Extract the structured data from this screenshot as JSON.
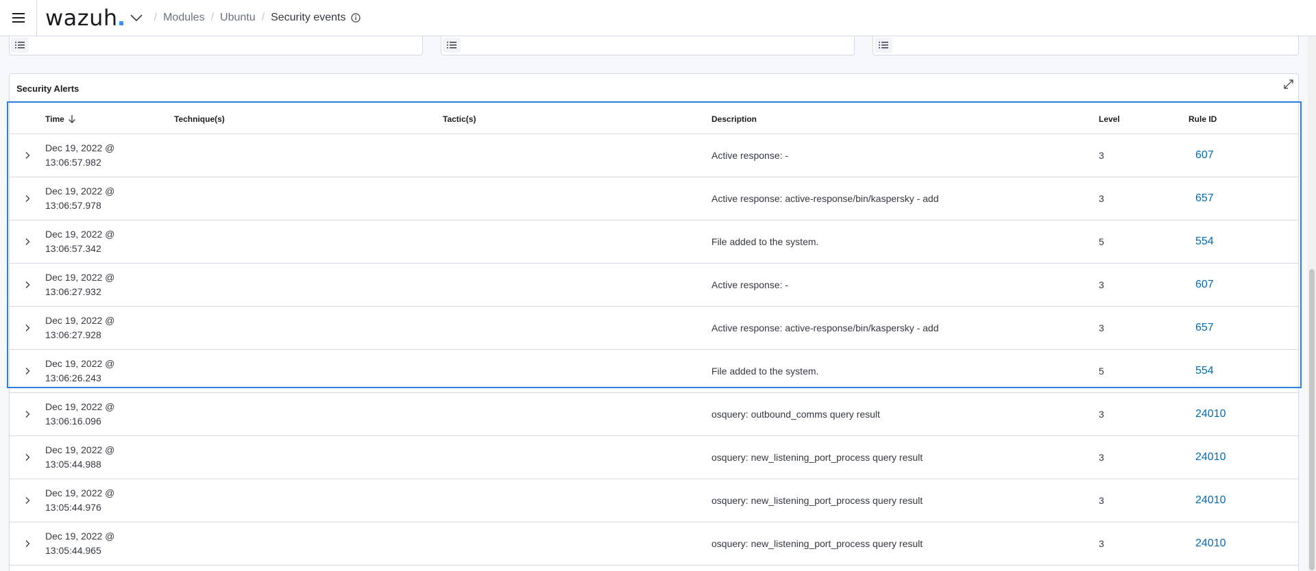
{
  "header": {
    "logo_text": "wazuh",
    "breadcrumbs": [
      {
        "label": "Modules"
      },
      {
        "label": "Ubuntu"
      },
      {
        "label": "Security events"
      }
    ]
  },
  "panel": {
    "title": "Security Alerts"
  },
  "table": {
    "columns": {
      "time": "Time",
      "technique": "Technique(s)",
      "tactic": "Tactic(s)",
      "description": "Description",
      "level": "Level",
      "rule_id": "Rule ID"
    },
    "rows": [
      {
        "date": "Dec 19, 2022 @",
        "clock": "13:06:57.982",
        "technique": "",
        "tactic": "",
        "description": "Active response: -",
        "level": "3",
        "rule_id": "607"
      },
      {
        "date": "Dec 19, 2022 @",
        "clock": "13:06:57.978",
        "technique": "",
        "tactic": "",
        "description": "Active response: active-response/bin/kaspersky - add",
        "level": "3",
        "rule_id": "657"
      },
      {
        "date": "Dec 19, 2022 @",
        "clock": "13:06:57.342",
        "technique": "",
        "tactic": "",
        "description": "File added to the system.",
        "level": "5",
        "rule_id": "554"
      },
      {
        "date": "Dec 19, 2022 @",
        "clock": "13:06:27.932",
        "technique": "",
        "tactic": "",
        "description": "Active response: -",
        "level": "3",
        "rule_id": "607"
      },
      {
        "date": "Dec 19, 2022 @",
        "clock": "13:06:27.928",
        "technique": "",
        "tactic": "",
        "description": "Active response: active-response/bin/kaspersky - add",
        "level": "3",
        "rule_id": "657"
      },
      {
        "date": "Dec 19, 2022 @",
        "clock": "13:06:26.243",
        "technique": "",
        "tactic": "",
        "description": "File added to the system.",
        "level": "5",
        "rule_id": "554"
      },
      {
        "date": "Dec 19, 2022 @",
        "clock": "13:06:16.096",
        "technique": "",
        "tactic": "",
        "description": "osquery: outbound_comms query result",
        "level": "3",
        "rule_id": "24010"
      },
      {
        "date": "Dec 19, 2022 @",
        "clock": "13:05:44.988",
        "technique": "",
        "tactic": "",
        "description": "osquery: new_listening_port_process query result",
        "level": "3",
        "rule_id": "24010"
      },
      {
        "date": "Dec 19, 2022 @",
        "clock": "13:05:44.976",
        "technique": "",
        "tactic": "",
        "description": "osquery: new_listening_port_process query result",
        "level": "3",
        "rule_id": "24010"
      },
      {
        "date": "Dec 19, 2022 @",
        "clock": "13:05:44.965",
        "technique": "",
        "tactic": "",
        "description": "osquery: new_listening_port_process query result",
        "level": "3",
        "rule_id": "24010"
      }
    ]
  },
  "colors": {
    "accent": "#006bb4",
    "highlight": "#2f7fe0",
    "logo_dot": "#3595f9"
  },
  "icons": {
    "menu": "hamburger-icon",
    "dropdown": "chevron-down-icon",
    "info": "info-icon",
    "legend": "list-icon",
    "expand": "fullscreen-icon",
    "sort": "arrow-down-icon",
    "row_expand": "chevron-right-icon"
  }
}
